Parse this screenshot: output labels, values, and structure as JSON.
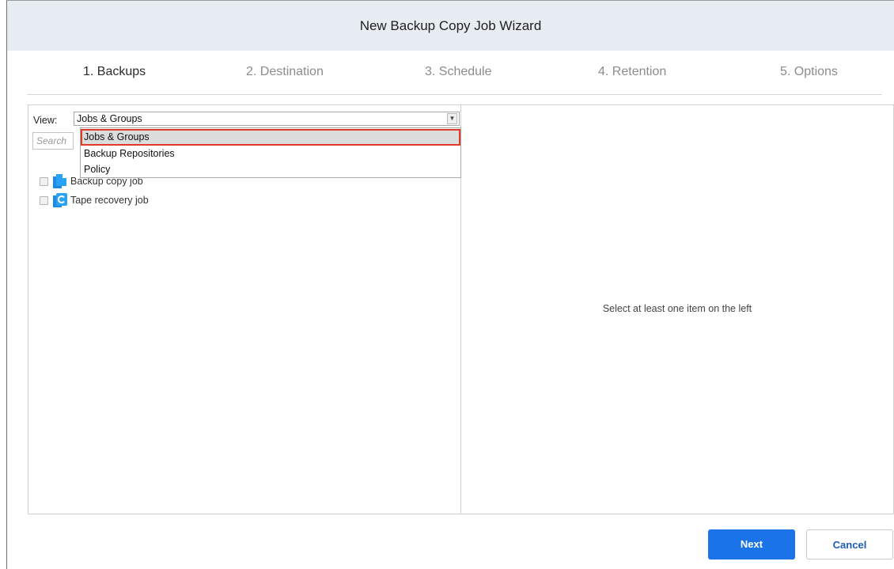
{
  "window": {
    "title": "New Backup Copy Job Wizard"
  },
  "steps": [
    {
      "label": "1. Backups",
      "active": true
    },
    {
      "label": "2. Destination",
      "active": false
    },
    {
      "label": "3. Schedule",
      "active": false
    },
    {
      "label": "4. Retention",
      "active": false
    },
    {
      "label": "5. Options",
      "active": false
    }
  ],
  "left_panel": {
    "view_label": "View:",
    "view_selected": "Jobs & Groups",
    "view_options": [
      "Jobs & Groups",
      "Backup Repositories",
      "Policy"
    ],
    "search_placeholder": "Search",
    "items": [
      {
        "label": "Backup copy job",
        "icon": "backup-copy-job-icon"
      },
      {
        "label": "Tape recovery job",
        "icon": "tape-recovery-job-icon"
      }
    ]
  },
  "right_panel": {
    "message": "Select at least one item on the left"
  },
  "buttons": {
    "next": "Next",
    "cancel": "Cancel"
  },
  "colors": {
    "accent": "#1a73e8",
    "highlight_border": "#e03a2c",
    "titlebar_bg": "#e8edf4"
  }
}
